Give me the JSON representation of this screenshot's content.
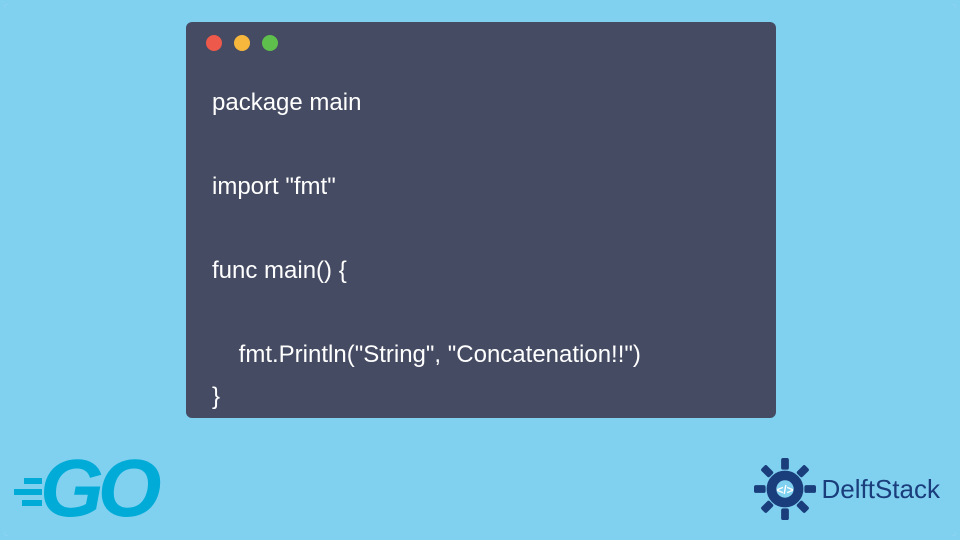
{
  "code": {
    "lines": [
      "package main",
      "",
      "import \"fmt\"",
      "",
      "func main() {",
      "",
      "    fmt.Println(\"String\", \"Concatenation!!\")",
      "}"
    ]
  },
  "logos": {
    "go_text": "GO",
    "delft_text": "DelftStack"
  },
  "colors": {
    "background": "#80d0f0",
    "window": "#454b62",
    "code_text": "#ffffff",
    "go_brand": "#00acd7",
    "delft_brand": "#1a3d7c"
  }
}
